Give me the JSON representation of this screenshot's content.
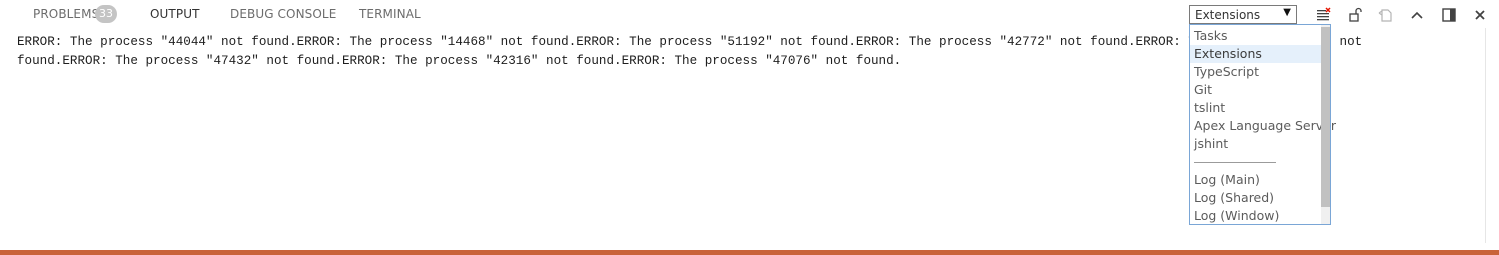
{
  "tabs": {
    "problems": {
      "label": "PROBLEMS",
      "badge": "33"
    },
    "output": {
      "label": "OUTPUT"
    },
    "debug_console": {
      "label": "DEBUG CONSOLE"
    },
    "terminal": {
      "label": "TERMINAL"
    }
  },
  "output": {
    "line1": "ERROR: The process \"44044\" not found.ERROR: The process \"14468\" not found.ERROR: The process \"51192\" not found.ERROR: The process \"42772\" not found.ERROR: The process \"47920\" not",
    "line2": "found.ERROR: The process \"47432\" not found.ERROR: The process \"42316\" not found.ERROR: The process \"47076\" not found."
  },
  "channel_select": {
    "value": "Extensions",
    "options": [
      "Tasks",
      "Extensions",
      "TypeScript",
      "Git",
      "tslint",
      "Apex Language Server",
      "jshint",
      "Log (Main)",
      "Log (Shared)",
      "Log (Window)"
    ]
  },
  "actions": {
    "clear": "clear-output-icon",
    "lock": "lock-scroll-icon",
    "open_log": "open-log-file-icon",
    "maximize": "chevron-up-icon",
    "toggle_layout": "split-panel-icon",
    "close": "close-icon"
  },
  "colors": {
    "accent_bottom": "#c9633a",
    "dropdown_border": "#7aa6d6",
    "selected_bg": "#e5f0fb",
    "clear_icon_red": "#e51400"
  }
}
